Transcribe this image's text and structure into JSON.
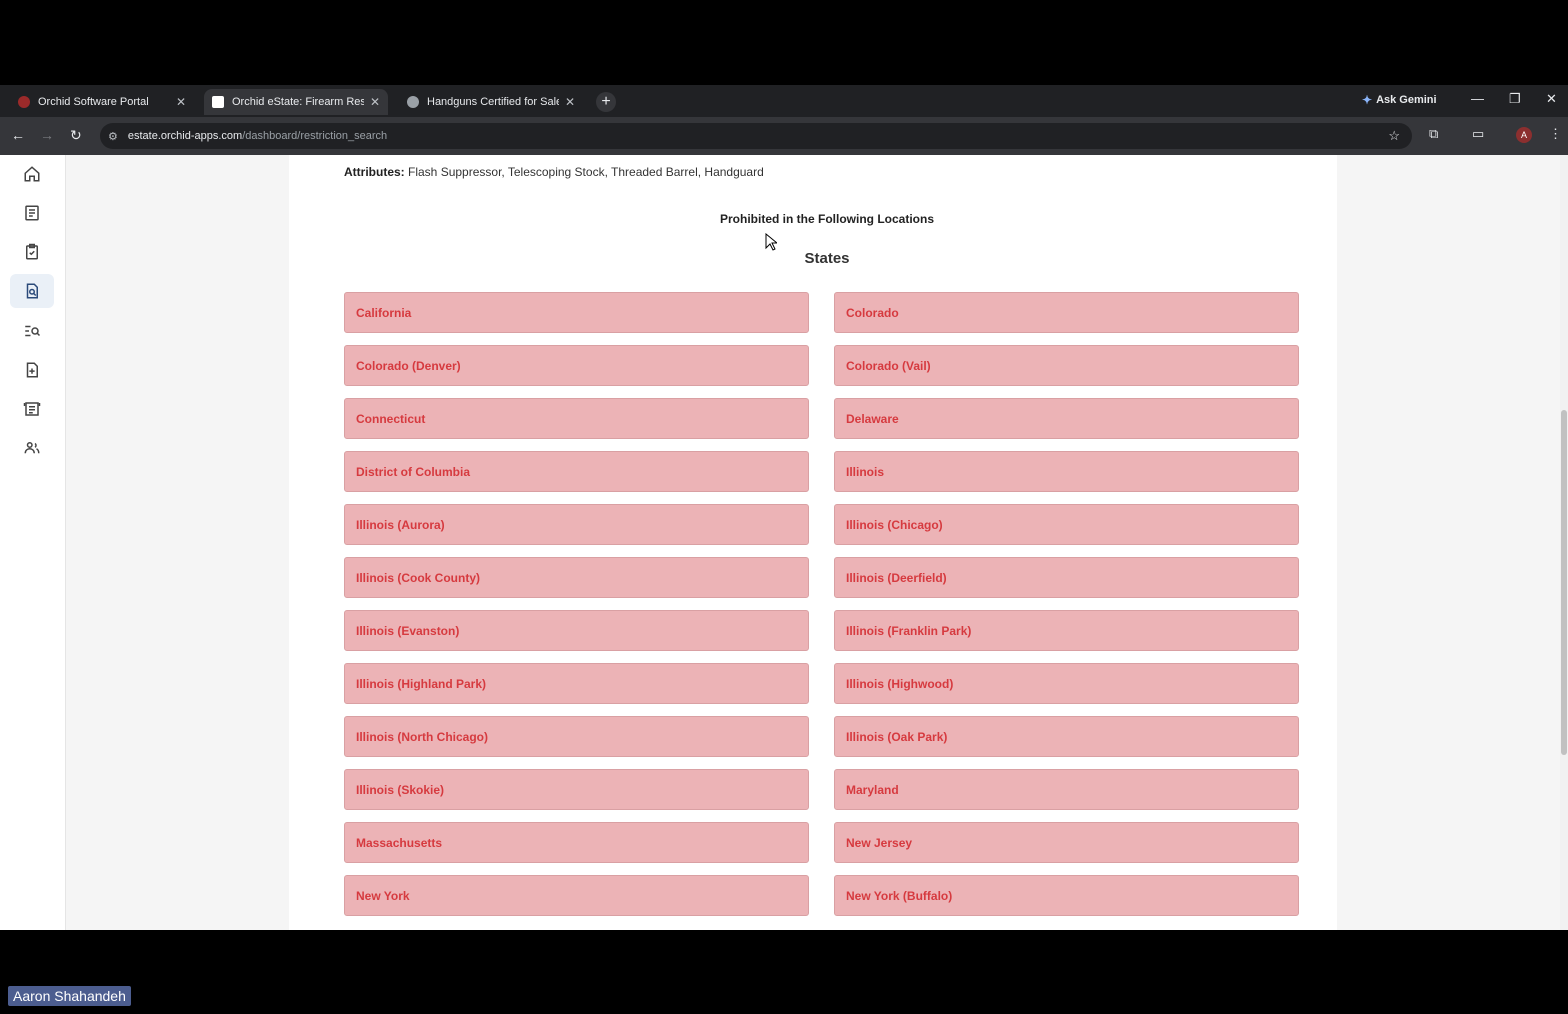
{
  "browser": {
    "tabs": [
      {
        "title": "Orchid Software Portal",
        "active": false,
        "favicon_color": "#9b2a2a"
      },
      {
        "title": "Orchid eState: Firearm Restrictio",
        "active": true,
        "favicon_color": "#ffffff"
      },
      {
        "title": "Handguns Certified for Sale | St",
        "active": false,
        "favicon_color": "#9aa0a6"
      }
    ],
    "ask_gemini": "Ask Gemini",
    "url_host": "estate.orchid-apps.com",
    "url_path": "/dashboard/restriction_search",
    "avatar_letter": "A"
  },
  "sidebar": {
    "items": [
      {
        "icon": "home-icon",
        "active": false
      },
      {
        "icon": "document-list-icon",
        "active": false
      },
      {
        "icon": "clipboard-check-icon",
        "active": false
      },
      {
        "icon": "document-search-icon",
        "active": true
      },
      {
        "icon": "list-search-icon",
        "active": false
      },
      {
        "icon": "file-add-icon",
        "active": false
      },
      {
        "icon": "report-icon",
        "active": false
      },
      {
        "icon": "users-icon",
        "active": false
      }
    ]
  },
  "content": {
    "attributes_label": "Attributes:",
    "attributes_value": "Flash Suppressor, Telescoping Stock, Threaded Barrel, Handguard",
    "prohibited_heading": "Prohibited in the Following Locations",
    "states_heading": "States",
    "locations": [
      "California",
      "Colorado",
      "Colorado (Denver)",
      "Colorado (Vail)",
      "Connecticut",
      "Delaware",
      "District of Columbia",
      "Illinois",
      "Illinois (Aurora)",
      "Illinois (Chicago)",
      "Illinois (Cook County)",
      "Illinois (Deerfield)",
      "Illinois (Evanston)",
      "Illinois (Franklin Park)",
      "Illinois (Highland Park)",
      "Illinois (Highwood)",
      "Illinois (North Chicago)",
      "Illinois (Oak Park)",
      "Illinois (Skokie)",
      "Maryland",
      "Massachusetts",
      "New Jersey",
      "New York",
      "New York (Buffalo)"
    ]
  },
  "overlay": {
    "presenter_name": "Aaron Shahandeh"
  },
  "colors": {
    "location_bg": "#ecb3b6",
    "location_text": "#d63a3f"
  }
}
